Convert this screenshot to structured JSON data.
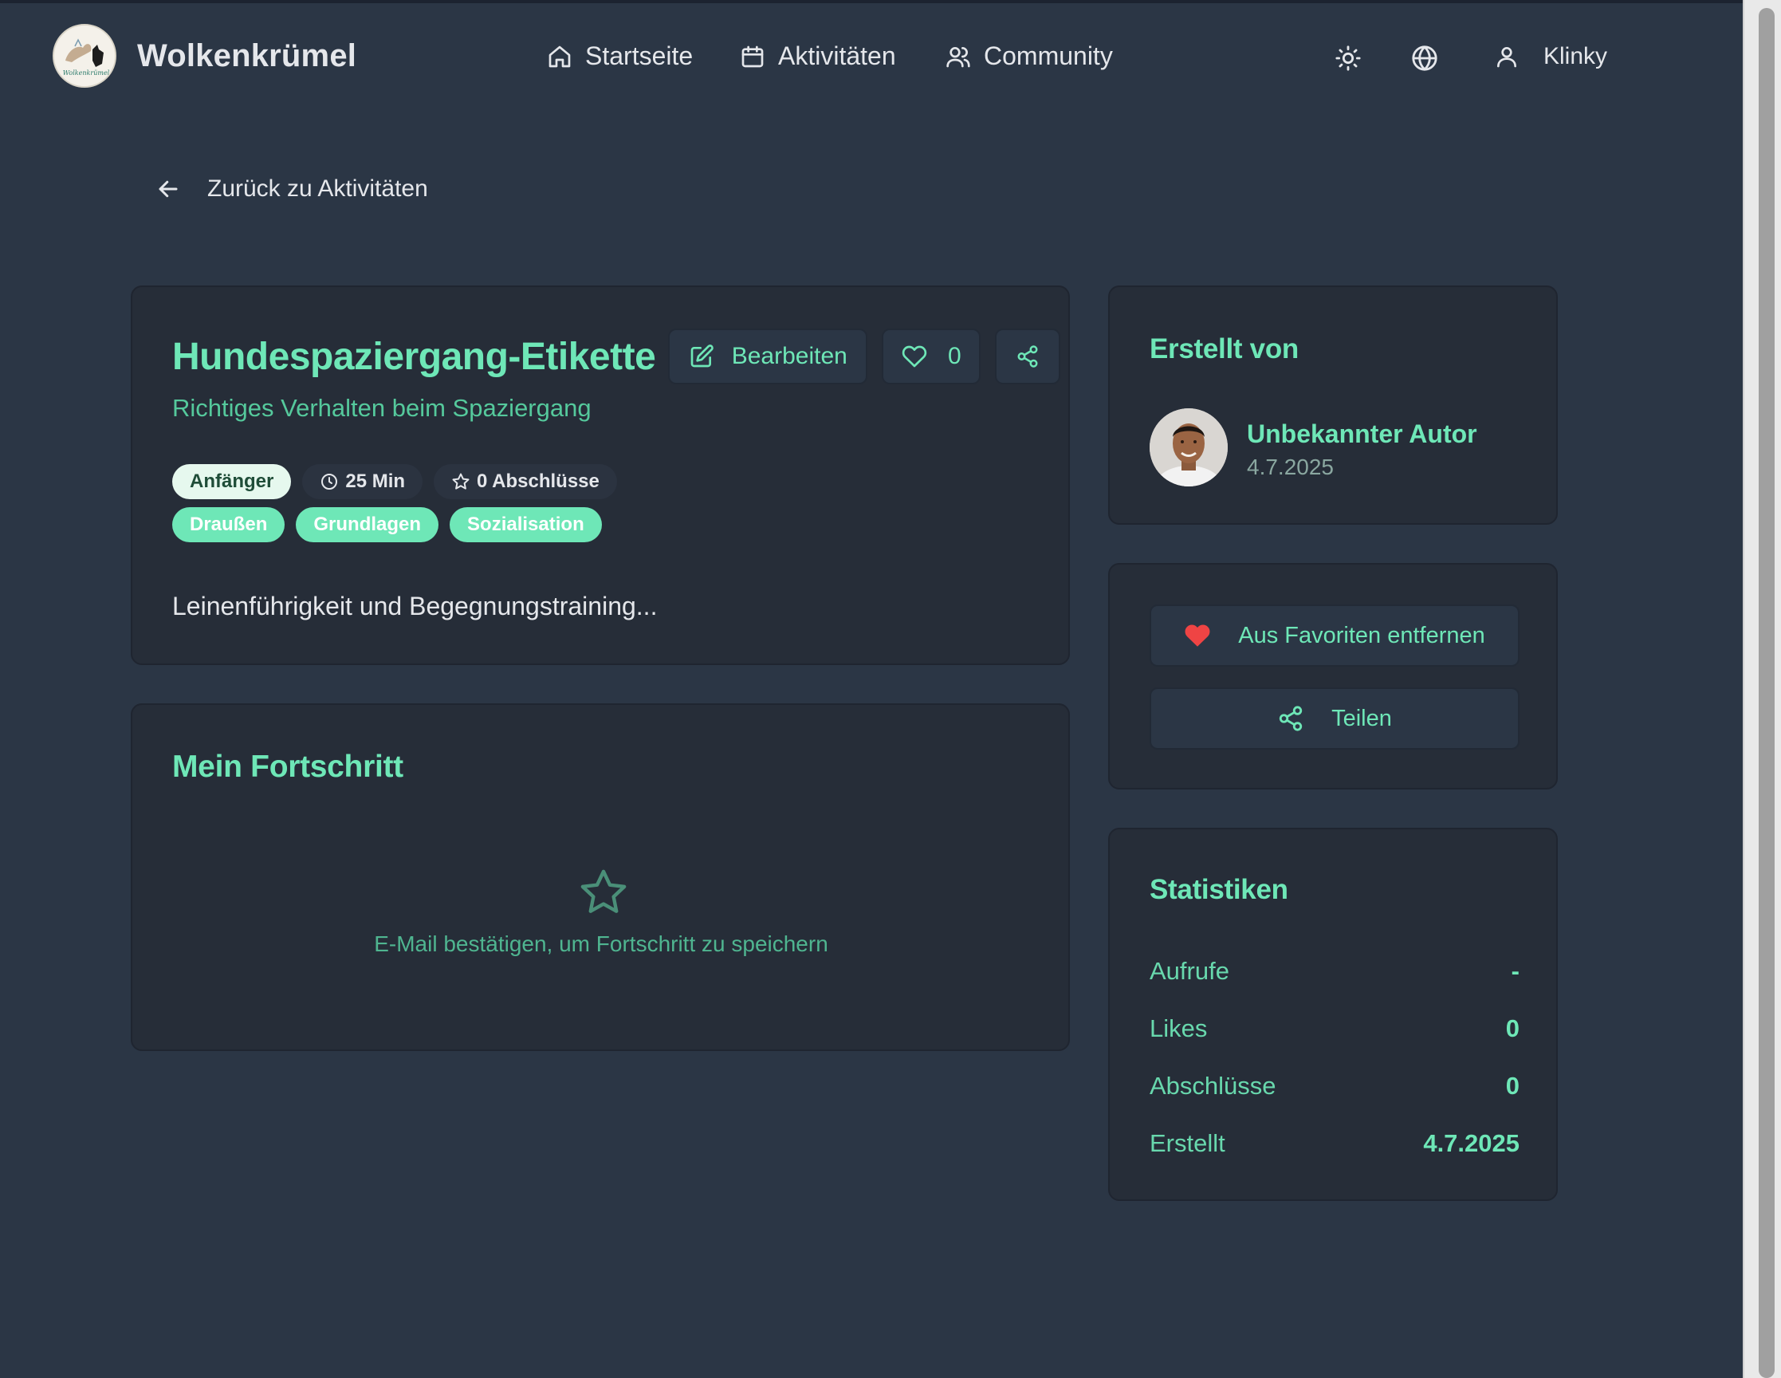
{
  "header": {
    "brand": "Wolkenkrümel",
    "logo_text": "Wolkenkrümel",
    "nav": [
      {
        "label": "Startseite",
        "icon": "home-icon"
      },
      {
        "label": "Aktivitäten",
        "icon": "calendar-icon"
      },
      {
        "label": "Community",
        "icon": "users-icon"
      }
    ],
    "theme_icon": "sun-icon",
    "language_icon": "globe-icon",
    "user_name": "Klinky"
  },
  "back_link": "Zurück zu Aktivitäten",
  "activity": {
    "title": "Hundespaziergang-Etikette",
    "edit_label": "Bearbeiten",
    "like_count": "0",
    "subtitle": "Richtiges Verhalten beim Spaziergang",
    "level": "Anfänger",
    "duration": "25 Min",
    "completions": "0 Abschlüsse",
    "tags": [
      "Draußen",
      "Grundlagen",
      "Sozialisation"
    ],
    "description": "Leinenführigkeit und Begegnungstraining..."
  },
  "progress": {
    "title": "Mein Fortschritt",
    "empty_text": "E-Mail bestätigen, um Fortschritt zu speichern"
  },
  "creator": {
    "title": "Erstellt von",
    "name": "Unbekannter Autor",
    "date": "4.7.2025"
  },
  "actions": {
    "favorite_label": "Aus Favoriten entfernen",
    "share_label": "Teilen"
  },
  "stats": {
    "title": "Statistiken",
    "rows": [
      {
        "label": "Aufrufe",
        "value": "-"
      },
      {
        "label": "Likes",
        "value": "0"
      },
      {
        "label": "Abschlüsse",
        "value": "0"
      },
      {
        "label": "Erstellt",
        "value": "4.7.2025"
      }
    ]
  },
  "colors": {
    "background": "#2b3645",
    "card": "#262d38",
    "accent": "#6ee7b7",
    "heart": "#ef4444"
  }
}
